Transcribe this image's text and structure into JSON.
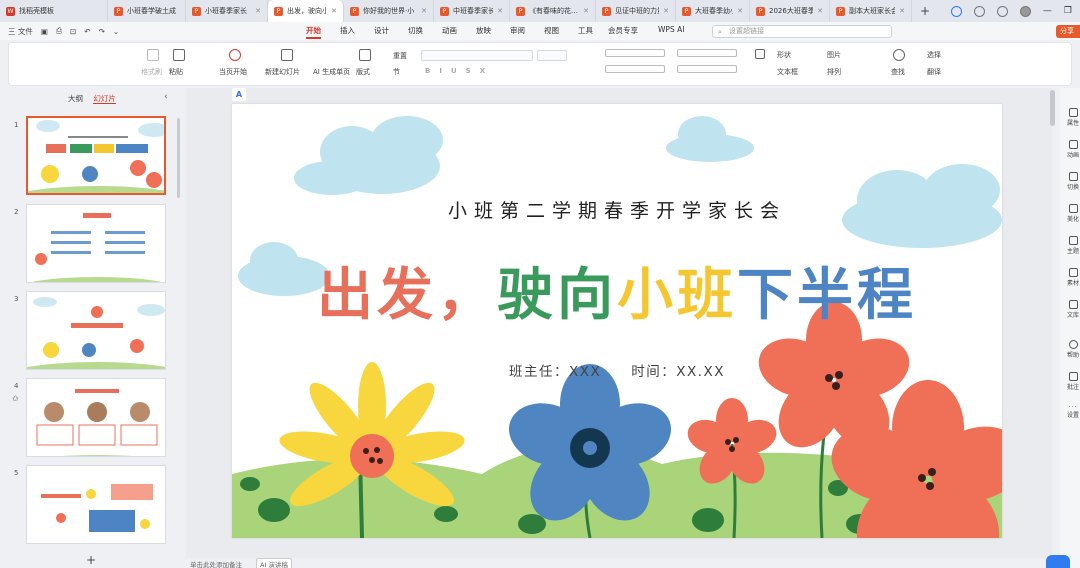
{
  "tabs": [
    {
      "label": "找稻壳模板",
      "icon": "wps-home-icon"
    },
    {
      "label": "小班春学破土成",
      "icon": "ppt-file-icon"
    },
    {
      "label": "小班春季家长",
      "icon": "ppt-file-icon"
    },
    {
      "label": "出发，驶向小",
      "icon": "ppt-file-icon",
      "active": true
    },
    {
      "label": "你好我的世界·小",
      "icon": "ppt-file-icon"
    },
    {
      "label": "中班春季家长",
      "icon": "ppt-file-icon"
    },
    {
      "label": "《有春味的花…",
      "icon": "ppt-file-icon"
    },
    {
      "label": "见证中班的力量",
      "icon": "ppt-file-icon"
    },
    {
      "label": "大班春季幼小",
      "icon": "ppt-file-icon"
    },
    {
      "label": "2026大班春季",
      "icon": "ppt-file-icon"
    },
    {
      "label": "副本大班家长会",
      "icon": "ppt-file-icon"
    }
  ],
  "new_tab": "+",
  "menu": {
    "file": "三 文件",
    "items": [
      "开始",
      "插入",
      "设计",
      "切换",
      "动画",
      "放映",
      "审阅",
      "视图",
      "工具",
      "会员专享",
      "WPS AI"
    ],
    "active": "开始",
    "search_placeholder": "设置超链接",
    "share": "分享"
  },
  "ribbon": {
    "format_painter": "格式刷",
    "paste": "粘贴",
    "play_current": "当页开始",
    "new_slide": "新建幻灯片",
    "ai_generate": "AI 生成单页",
    "layout": "版式",
    "section": "节",
    "reset": "重置",
    "shape": "形状",
    "picture": "图片",
    "textbox": "文本框",
    "arrange": "排列",
    "find": "查找",
    "select": "选择",
    "translate": "翻译"
  },
  "left_panel": {
    "outline_tab": "大纲",
    "slides_tab": "幻灯片",
    "slide_numbers": [
      "1",
      "2",
      "3",
      "4",
      "5"
    ],
    "add": "+"
  },
  "slide": {
    "subtitle": "小班第二学期春季开学家长会",
    "title_parts": [
      {
        "text": "出发，",
        "color": "#e8705a"
      },
      {
        "text": "驶向",
        "color": "#3a9a5c"
      },
      {
        "text": "小班",
        "color": "#f4c730"
      },
      {
        "text": "下半程",
        "color": "#4d85c4"
      }
    ],
    "byline": "班主任：XXX　　时间：XX.XX"
  },
  "right_rail": [
    "属性",
    "动画",
    "切换",
    "美化",
    "主题",
    "素材",
    "文库",
    "帮助",
    "批注",
    "设置"
  ],
  "status": {
    "notes": "单击此处添加备注",
    "ai": "AI 演讲稿"
  },
  "colors": {
    "accent": "#d9372a",
    "orange": "#e8592b",
    "flower_red": "#ef6f57",
    "flower_blue": "#4f86c2",
    "flower_yellow": "#f8d63e",
    "grass": "#a9d47a",
    "cloud": "#bfe3ef"
  }
}
